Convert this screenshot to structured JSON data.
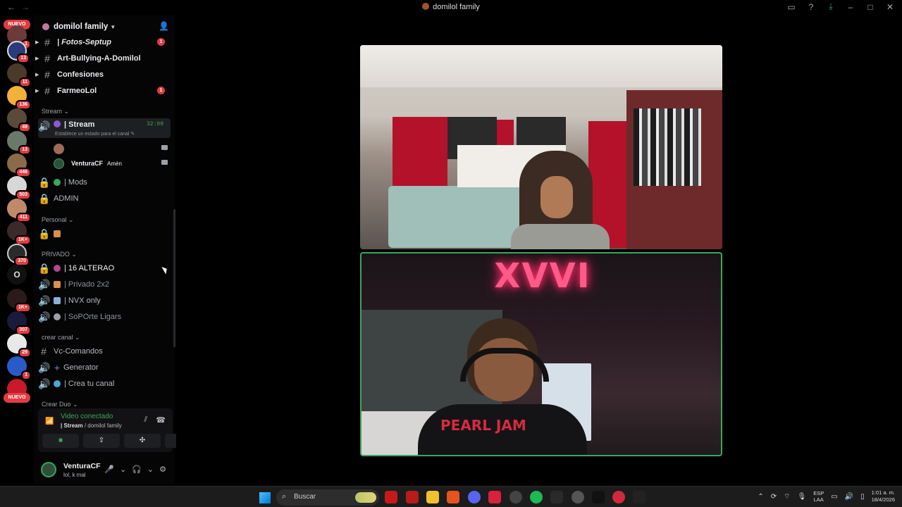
{
  "window": {
    "title": "domilol family",
    "icons": [
      "back-arrow",
      "forward-arrow",
      "inbox-icon",
      "help-icon",
      "download-icon",
      "minimize-icon",
      "maximize-icon",
      "close-icon"
    ]
  },
  "rail": {
    "nuevo_top": "NUEVO",
    "nuevo_bottom": "NUEVO",
    "badges": [
      "1",
      "13",
      "11",
      "136",
      "49",
      "13",
      "446",
      "503",
      "411",
      "1K+",
      "370",
      "1K+",
      "307",
      "29",
      "1"
    ],
    "o_label": "O"
  },
  "server": {
    "name": "domilol family"
  },
  "channels": {
    "fotos": {
      "label": "| Fotos-Septup",
      "badge": "1"
    },
    "art": {
      "label": "Art-Bullying-A-Domilol"
    },
    "confesiones": {
      "label": "Confesiones"
    },
    "farmeo": {
      "label": "FarmeoLol",
      "badge": "1"
    }
  },
  "categories": {
    "stream": "Stream",
    "personal": "Personal",
    "privado": "PRIVADO",
    "crear_canal": "crear canal",
    "crear_duo": "Crear Duo"
  },
  "stream_channel": {
    "label": "| Stream",
    "time": "32:09",
    "status": "Establece un estado para el canal"
  },
  "voice_users": [
    {
      "name": "",
      "extra": ""
    },
    {
      "name": "VenturaCF",
      "extra": "Amén"
    }
  ],
  "stream_cat_channels": {
    "mods": "| Mods",
    "admin": "ADMIN"
  },
  "privado_channels": {
    "alterao": "| 16 ALTERAO",
    "privado2x2": "| Privado 2x2",
    "nvx": "| NVX only",
    "soporte": "| SoPOrte Ligars"
  },
  "crear_channels": {
    "comandos": "Vc-Comandos",
    "generator": "Generator",
    "crea": "| Crea tu canal"
  },
  "voice_panel": {
    "title": "Video conectado",
    "channel": "| Stream",
    "server": "/ domilol family"
  },
  "user_panel": {
    "name": "VenturaCF",
    "status": "lol, k mal"
  },
  "videos": {
    "shirt_text": "PEARL JAM",
    "neon_text": "XVVI"
  },
  "taskbar": {
    "search_placeholder": "Buscar",
    "lang_line1": "ESP",
    "lang_line2": "LAA",
    "time": "1:01 a. m.",
    "date": "18/4/2026"
  },
  "colors": {
    "accent_green": "#3ba55c",
    "badge_red": "#e23c40",
    "background": "#000000"
  }
}
